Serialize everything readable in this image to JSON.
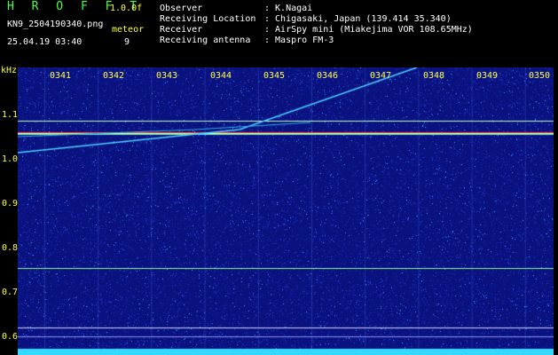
{
  "header": {
    "title": "H R O F F T",
    "version": "1.0.0f",
    "filename": "KN9_2504190340.png",
    "meteor_label": "meteor",
    "meteor_count": "9",
    "datetime": "25.04.19 03:40"
  },
  "info": {
    "observer_label": "Observer",
    "observer_value": ": K.Nagai",
    "location_label": "Receiving Location",
    "location_value": ": Chigasaki, Japan (139.414 35.340)",
    "receiver_label": "Receiver",
    "receiver_value": ": AirSpy mini (Miakejima VOR 108.65MHz)",
    "antenna_label": "Receiving antenna",
    "antenna_value": ": Maspro FM-3"
  },
  "axis": {
    "unit": "kHz",
    "y_ticks": [
      "1.1",
      "1.0",
      "0.9",
      "0.8",
      "0.7",
      "0.6"
    ],
    "x_ticks": [
      "0341",
      "0342",
      "0343",
      "0344",
      "0345",
      "0346",
      "0347",
      "0348",
      "0349",
      "0350"
    ]
  },
  "colors": {
    "background": "#0a1280",
    "text_yellow": "#ffff44",
    "signal_cyan": "#4dd0ff",
    "carrier_red": "#ff4040"
  }
}
